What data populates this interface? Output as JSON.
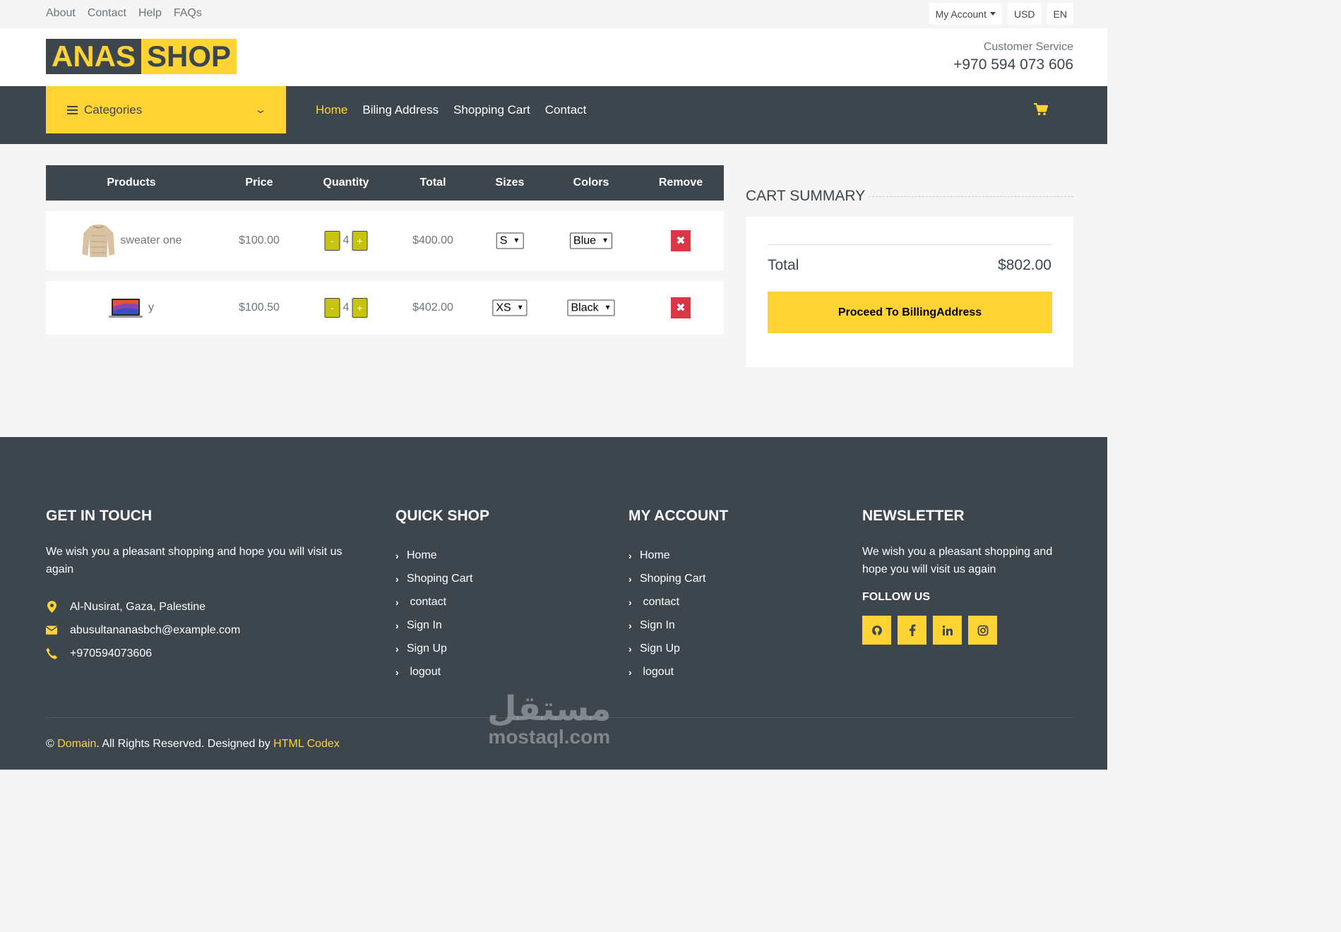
{
  "topbar": {
    "links": [
      "About",
      "Contact",
      "Help",
      "FAQs"
    ],
    "account": "My Account",
    "currency": "USD",
    "language": "EN"
  },
  "header": {
    "logo_part1": "ANAS",
    "logo_part2": "SHOP",
    "cs_label": "Customer Service",
    "cs_phone": "+970 594 073 606"
  },
  "nav": {
    "categories": "Categories",
    "links": [
      "Home",
      "Biling Address",
      "Shopping Cart",
      "Contact"
    ]
  },
  "cart": {
    "headers": [
      "Products",
      "Price",
      "Quantity",
      "Total",
      "Sizes",
      "Colors",
      "Remove"
    ],
    "rows": [
      {
        "name": "sweater one",
        "price": "$100.00",
        "qty": "4",
        "total": "$400.00",
        "size": "S",
        "color": "Blue"
      },
      {
        "name": "y",
        "price": "$100.50",
        "qty": "4",
        "total": "$402.00",
        "size": "XS",
        "color": "Black"
      }
    ],
    "minus": "-",
    "plus": "+",
    "remove": "✖"
  },
  "summary": {
    "title": "CART SUMMARY",
    "total_label": "Total",
    "total_value": "$802.00",
    "button": "Proceed To BillingAddress"
  },
  "footer": {
    "touch": {
      "title": "GET IN TOUCH",
      "text": "We wish you a pleasant shopping and hope you will visit us again",
      "address": "Al-Nusirat, Gaza, Palestine",
      "email": "abusultananasbch@example.com",
      "phone": "+970594073606"
    },
    "quick": {
      "title": "QUICK SHOP",
      "items": [
        "Home",
        "Shoping Cart",
        " contact",
        "Sign In",
        "Sign Up",
        " logout"
      ]
    },
    "account": {
      "title": "MY ACCOUNT",
      "items": [
        "Home",
        "Shoping Cart",
        " contact",
        "Sign In",
        "Sign Up",
        " logout"
      ]
    },
    "newsletter": {
      "title": "NEWSLETTER",
      "text": "We wish you a pleasant shopping and hope you will visit us again",
      "follow": "FOLLOW US"
    },
    "copyright": {
      "pre": "© ",
      "domain": "Domain",
      "mid": ". All Rights Reserved. Designed by ",
      "designer": "HTML Codex"
    }
  },
  "watermark": {
    "arabic": "مستقل",
    "latin": "mostaql.com"
  },
  "colors": {
    "accent": "#ffd333",
    "dark": "#3d464d",
    "danger": "#dc3545",
    "qty": "#c6c40e"
  }
}
